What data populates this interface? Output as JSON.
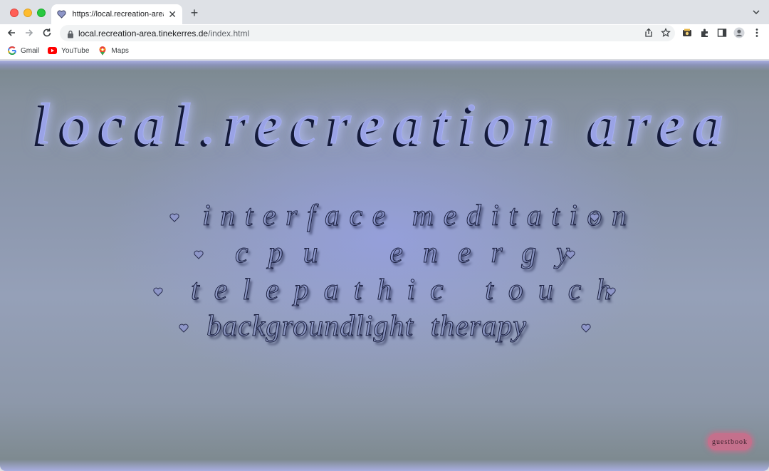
{
  "browser": {
    "tab_title": "https://local.recreation-area.tinekerres.de/index.html",
    "url_host": "local.recreation-area.tinekerres.de",
    "url_path": "/index.html",
    "bookmarks": [
      {
        "label": "Gmail",
        "icon": "gmail-icon"
      },
      {
        "label": "YouTube",
        "icon": "youtube-icon"
      },
      {
        "label": "Maps",
        "icon": "maps-icon"
      }
    ]
  },
  "page": {
    "headline": "local.recreation area",
    "menu": [
      {
        "label": "interface meditation"
      },
      {
        "label": "cpu energy"
      },
      {
        "label": "telepathic touch"
      },
      {
        "label": "backgroundlight therapy"
      }
    ],
    "guestbook_label": "guestbook"
  },
  "colors": {
    "accent": "#9aa3e6",
    "guestbook": "#c4708c"
  }
}
